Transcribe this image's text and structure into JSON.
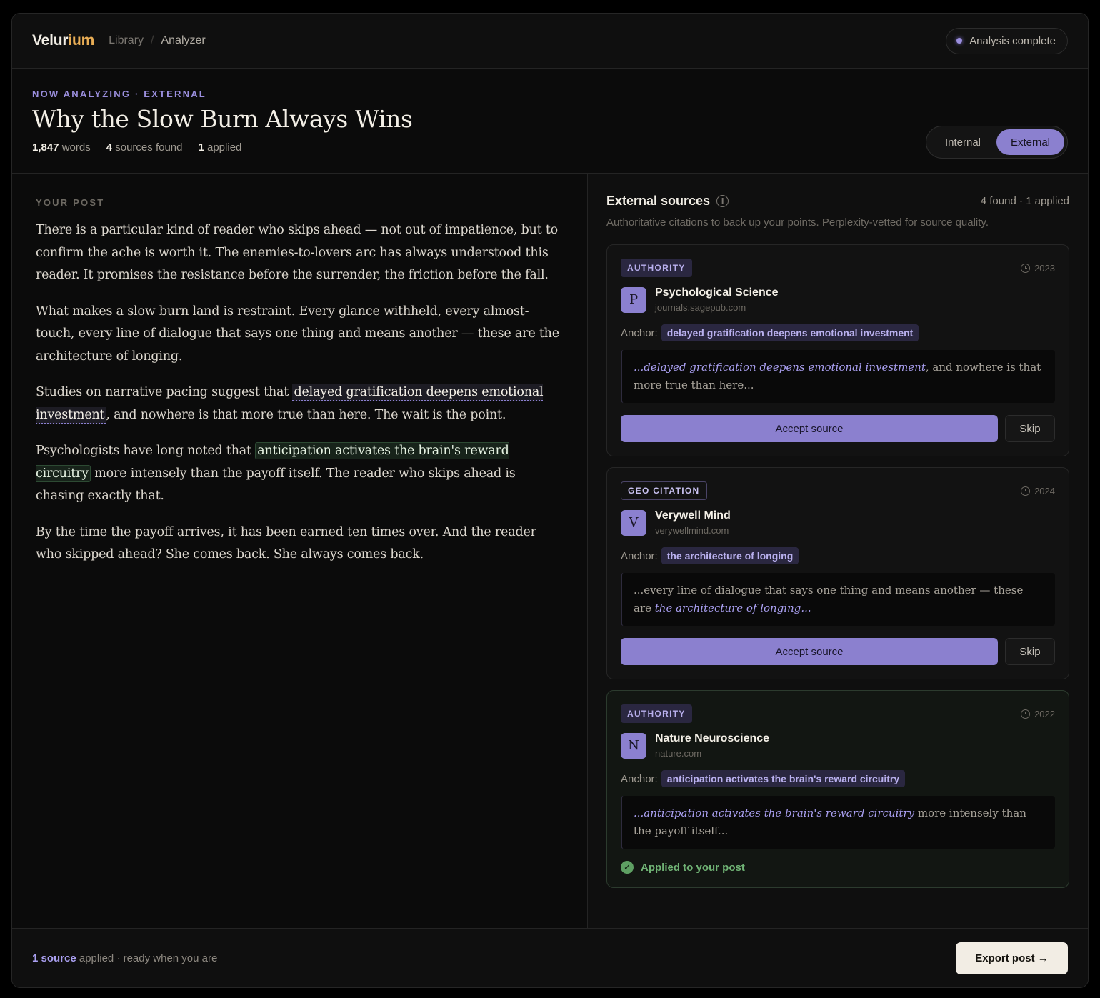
{
  "app": {
    "logo_main": "Velur",
    "logo_accent": "ium"
  },
  "breadcrumb": {
    "library": "Library",
    "separator": "/",
    "current": "Analyzer"
  },
  "status": {
    "label": "Analysis complete"
  },
  "header": {
    "eyebrow": "NOW ANALYZING · EXTERNAL",
    "title": "Why the Slow Burn Always Wins",
    "stats": {
      "words_value": "1,847",
      "words_label": "words",
      "sources_value": "4",
      "sources_label": "sources found",
      "applied_value": "1",
      "applied_label": "applied"
    },
    "toggle": {
      "internal": "Internal",
      "external": "External",
      "selected": "External"
    }
  },
  "post": {
    "section_label": "YOUR POST",
    "p1": "There is a particular kind of reader who skips ahead — not out of impatience, but to confirm the ache is worth it. The enemies-to-lovers arc has always understood this reader. It promises the resistance before the surrender, the friction before the fall.",
    "p2": "What makes a slow burn land is restraint. Every glance withheld, every almost-touch, every line of dialogue that says one thing and means another — these are the architecture of longing.",
    "p3_before": "Studies on narrative pacing suggest that ",
    "p3_highlight": "delayed gratification deepens emotional investment",
    "p3_after": ", and nowhere is that more true than here. The wait is the point.",
    "p4_before": "Psychologists have long noted that ",
    "p4_highlight": "anticipation activates the brain's reward circuitry",
    "p4_after": " more intensely than the payoff itself. The reader who skips ahead is chasing exactly that.",
    "p5": "By the time the payoff arrives, it has been earned ten times over. And the reader who skipped ahead? She comes back. She always comes back."
  },
  "external": {
    "title": "External sources",
    "count": "4 found · 1 applied",
    "subtitle": "Authoritative citations to back up your points. Perplexity-vetted for source quality.",
    "anchor_label": "Anchor:",
    "accept_label": "Accept source",
    "skip_label": "Skip",
    "cards": [
      {
        "badge": "AUTHORITY",
        "year": "2023",
        "initial": "P",
        "name": "Psychological Science",
        "domain": "journals.sagepub.com",
        "anchor": "delayed gratification deepens emotional investment",
        "excerpt_before": "",
        "excerpt_em": "...delayed gratification deepens emotional investment",
        "excerpt_after": ", and nowhere is that more true than here..."
      },
      {
        "badge": "GEO CITATION",
        "year": "2024",
        "initial": "V",
        "name": "Verywell Mind",
        "domain": "verywellmind.com",
        "anchor": "the architecture of longing",
        "excerpt_before": "...every line of dialogue that says one thing and means another — these are ",
        "excerpt_em": "the architecture of longing...",
        "excerpt_after": ""
      },
      {
        "badge": "AUTHORITY",
        "year": "2022",
        "initial": "N",
        "name": "Nature Neuroscience",
        "domain": "nature.com",
        "anchor": "anticipation activates the brain's reward circuitry",
        "excerpt_before": "",
        "excerpt_em": "...anticipation activates the brain's reward circuitry",
        "excerpt_after": " more intensely than the payoff itself...",
        "applied_label": "Applied to your post"
      }
    ]
  },
  "footer": {
    "count": "1 source",
    "text": " applied · ready when you are",
    "export_label": "Export post →"
  },
  "colors": {
    "accent": "#8b80cf",
    "brand_accent": "#e8ad55",
    "applied_green": "#6fb274"
  }
}
